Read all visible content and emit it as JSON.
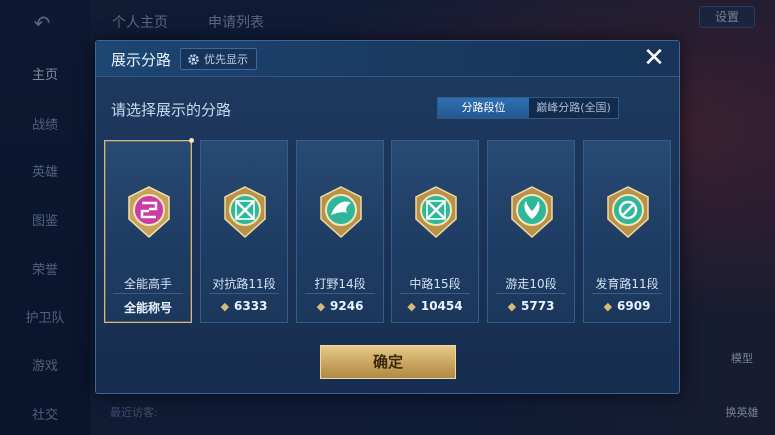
{
  "background": {
    "back_icon": "back-arrow-icon",
    "top_tabs": [
      "个人主页",
      "申请列表"
    ],
    "settings_label": "设置",
    "sidebar": [
      "主页",
      "战绩",
      "英雄",
      "图鉴",
      "荣誉",
      "护卫队",
      "游戏",
      "社交"
    ],
    "right_buttons": [
      "模型",
      "换英雄"
    ],
    "recent_visitors_label": "最近访客:"
  },
  "modal": {
    "title": "展示分路",
    "priority_button": "优先显示",
    "priority_icon": "gear-icon",
    "close_icon": "close-icon",
    "subtitle": "请选择展示的分路",
    "segments": [
      {
        "label": "分路段位",
        "active": true
      },
      {
        "label": "巅峰分路(全国)",
        "active": false
      }
    ],
    "cards": [
      {
        "name": "全能高手",
        "score": "全能称号",
        "color": "#c93ba9",
        "selected": true,
        "show_gem": false
      },
      {
        "name": "对抗路11段",
        "score": "6333",
        "color": "#2fb79a",
        "selected": false,
        "show_gem": true
      },
      {
        "name": "打野14段",
        "score": "9246",
        "color": "#2fb79a",
        "selected": false,
        "show_gem": true
      },
      {
        "name": "中路15段",
        "score": "10454",
        "color": "#2fb79a",
        "selected": false,
        "show_gem": true
      },
      {
        "name": "游走10段",
        "score": "5773",
        "color": "#2fb79a",
        "selected": false,
        "show_gem": true
      },
      {
        "name": "发育路11段",
        "score": "6909",
        "color": "#2fb79a",
        "selected": false,
        "show_gem": true
      }
    ],
    "confirm_label": "确定"
  }
}
